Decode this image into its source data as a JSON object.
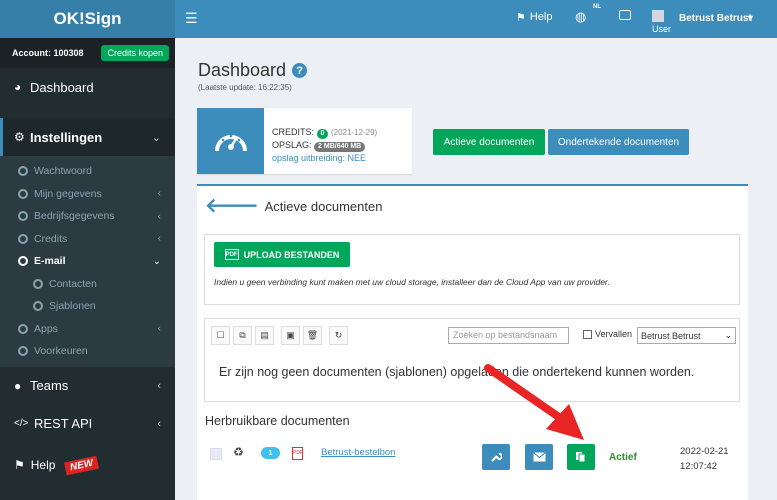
{
  "app": {
    "logo": "OK!Sign"
  },
  "account": {
    "label": "Account: 100308",
    "credits_button": "Credits kopen"
  },
  "sidebar": {
    "dashboard": "Dashboard",
    "instellingen": "Instellingen",
    "sub": [
      "Wachtwoord",
      "Mijn gegevens",
      "Bedrijfsgegevens",
      "Credits",
      "E-mail",
      "Contacten",
      "Sjablonen",
      "Apps",
      "Voorkeuren"
    ],
    "teams": "Teams",
    "rest_api": "REST API",
    "help": "Help",
    "new_badge": "NEW"
  },
  "topbar": {
    "help": "Help",
    "lang": "NL",
    "user_img_alt": "User",
    "user_name": "Betrust Betrust"
  },
  "page": {
    "title": "Dashboard",
    "last_update": "(Laatste update: 16:22:35)",
    "credits_label": "CREDITS:",
    "credits_value": "0",
    "credits_date": "(2021-12-29)",
    "storage_label": "OPSLAG:",
    "storage_value": "2 MB/640 MB",
    "storage_ext": "opslag uitbreiding: NEE",
    "btn_active": "Actieve documenten",
    "btn_signed": "Ondertekende documenten"
  },
  "active_docs": {
    "title": "Actieve documenten",
    "upload_button": "UPLOAD BESTANDEN",
    "upload_note": "Indien u geen verbinding kunt maken met uw cloud storage, installeer dan de Cloud App van uw provider.",
    "search_placeholder": "Zoeken op bestandsnaam",
    "expired_label": "Vervallen",
    "select_value": "Betrust Betrust",
    "empty_message": "Er zijn nog geen documenten (sjablonen) opgeladen die ondertekend kunnen worden."
  },
  "reusable": {
    "title": "Herbruikbare documenten",
    "doc": {
      "count": "1",
      "name": "Betrust-bestelbon",
      "status": "Actief",
      "date": "2022-02-21",
      "time": "12:07:42"
    }
  },
  "colors": {
    "primary": "#3c8dbc",
    "success": "#00a65a",
    "sidebar": "#222d32",
    "arrow": "#e82424"
  }
}
